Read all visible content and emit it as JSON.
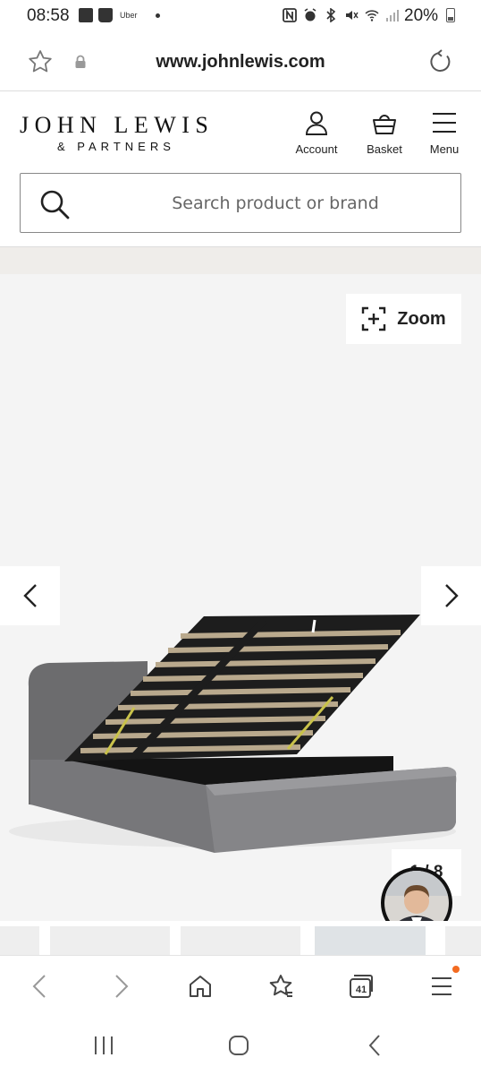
{
  "status_bar": {
    "time": "08:58",
    "notification_text": "Uber",
    "battery": "20%",
    "icons": [
      "image-icon",
      "shopping-bag-icon",
      "nfc-icon",
      "alarm-icon",
      "bluetooth-icon",
      "mute-icon",
      "wifi-icon",
      "signal-icon",
      "battery-icon"
    ]
  },
  "browser": {
    "url": "www.johnlewis.com",
    "tab_count": "41"
  },
  "header": {
    "logo_line1": "JOHN LEWIS",
    "logo_line2": "& PARTNERS",
    "account_label": "Account",
    "basket_label": "Basket",
    "menu_label": "Menu"
  },
  "search": {
    "placeholder": "Search product or brand"
  },
  "gallery": {
    "zoom_label": "Zoom",
    "counter": "1 / 8"
  },
  "colors": {
    "brand_text": "#111111",
    "gallery_bg": "#f4f4f4",
    "band_bg": "#efedea",
    "notify_dot": "#f36b21"
  }
}
